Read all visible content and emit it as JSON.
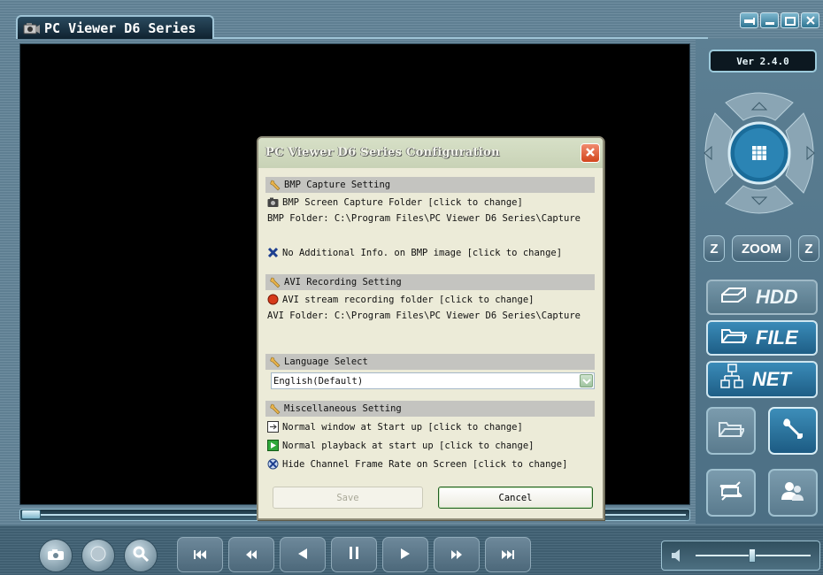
{
  "app": {
    "title": "PC Viewer D6 Series",
    "version": "Ver 2.4.0"
  },
  "right_panel": {
    "zoom_label": "ZOOM",
    "zoom_in_label": "Z",
    "zoom_out_label": "Z",
    "hdd_label": "HDD",
    "file_label": "FILE",
    "net_label": "NET"
  },
  "dialog": {
    "title": "PC Viewer D6 Series Configuration",
    "bmp_section": "BMP Capture Setting",
    "bmp_folder_action": "BMP Screen Capture Folder [click to change]",
    "bmp_folder_path": "BMP Folder: C:\\Program Files\\PC Viewer D6 Series\\Capture",
    "bmp_info_action": "No Additional Info. on BMP image [click to change]",
    "avi_section": "AVI Recording Setting",
    "avi_folder_action": "AVI stream recording folder [click to change]",
    "avi_folder_path": "AVI Folder: C:\\Program Files\\PC Viewer D6 Series\\Capture",
    "language_section": "Language Select",
    "language_value": "English(Default)",
    "misc_section": "Miscellaneous Setting",
    "misc_window": "Normal window at Start up [click to change]",
    "misc_playback": "Normal playback at start up [click to change]",
    "misc_framerate": "Hide Channel Frame Rate on Screen [click to change]",
    "save_label": "Save",
    "cancel_label": "Cancel"
  },
  "playback": {
    "seek_position": 0.02,
    "volume_level": 0.5
  },
  "icons": [
    "app-icon",
    "pin-icon",
    "minimize-icon",
    "maximize-icon",
    "close-icon",
    "dpad-up-icon",
    "dpad-down-icon",
    "dpad-left-icon",
    "dpad-right-icon",
    "grid-icon",
    "hdd-icon",
    "folder-icon",
    "network-icon",
    "open-folder-icon",
    "wrench-icon",
    "transfer-icon",
    "users-icon",
    "camera-icon",
    "record-icon",
    "search-icon",
    "skip-first-icon",
    "rewind-icon",
    "play-reverse-icon",
    "pause-icon",
    "play-icon",
    "fast-forward-icon",
    "skip-last-icon",
    "speaker-icon"
  ],
  "colors": {
    "panel_bg": "#5c7f93",
    "accent_blue": "#1e5e86",
    "dialog_bg": "#ecebd8",
    "close_red": "#d2451c"
  }
}
